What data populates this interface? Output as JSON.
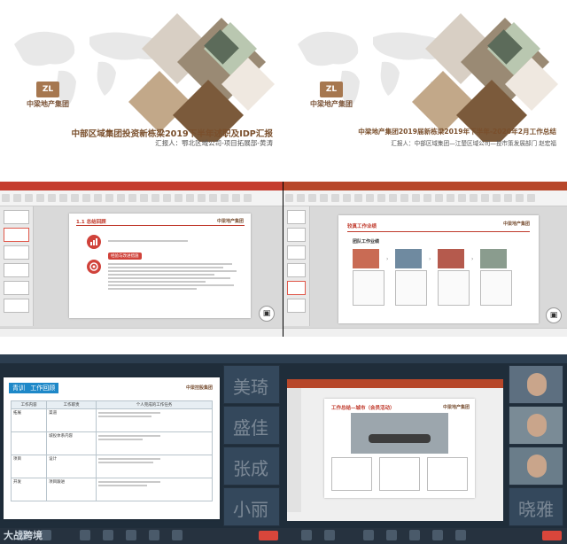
{
  "cover_left": {
    "logo_text": "中梁地产集团",
    "logo_mark": "ZL",
    "title": "中部区域集团投资新栋梁2019下半年述职及IDP汇报",
    "subtitle": "汇报人：鄂北区域公司-项目拓展部-黄涛"
  },
  "cover_right": {
    "logo_text": "中梁地产集团",
    "logo_mark": "ZL",
    "title": "中梁地产集团2019届新栋梁2019年下半年-2020年2月工作总结",
    "subtitle": "汇报人：中部区域集团—江楚区域公司—投市策发展部门 赵宏福"
  },
  "ppt_left": {
    "heading": "1.1 总结回顾",
    "section_label": "经验与改进措施",
    "brand": "中梁地产集团"
  },
  "ppt_right": {
    "heading": "较真工作业绩",
    "sub_heading": "团队工作业绩",
    "brand": "中梁地产集团"
  },
  "meeting_left": {
    "badge": "青训",
    "section": "工作回顾",
    "brand": "中梁控股集团",
    "table_headers": [
      "工作内容",
      "工作职责",
      "个人完成的工作任务"
    ],
    "rows": [
      [
        "拓展",
        "渠道"
      ],
      [
        "",
        "城投体系内容"
      ],
      [
        "项目",
        "设计"
      ],
      [
        "开发",
        "项目跟进"
      ]
    ],
    "attendees": [
      "美琦",
      "盛佳",
      "张成",
      "小丽"
    ]
  },
  "meeting_right": {
    "heading": "工作总结—城市（会员活动）",
    "brand": "中梁地产集团",
    "attendees": [
      "晓雅"
    ]
  },
  "watermark": "大战跨境",
  "colors": {
    "brand_brown": "#7a5236",
    "ppt_red": "#c53d2f",
    "meeting_bg": "#1f2d3a"
  }
}
